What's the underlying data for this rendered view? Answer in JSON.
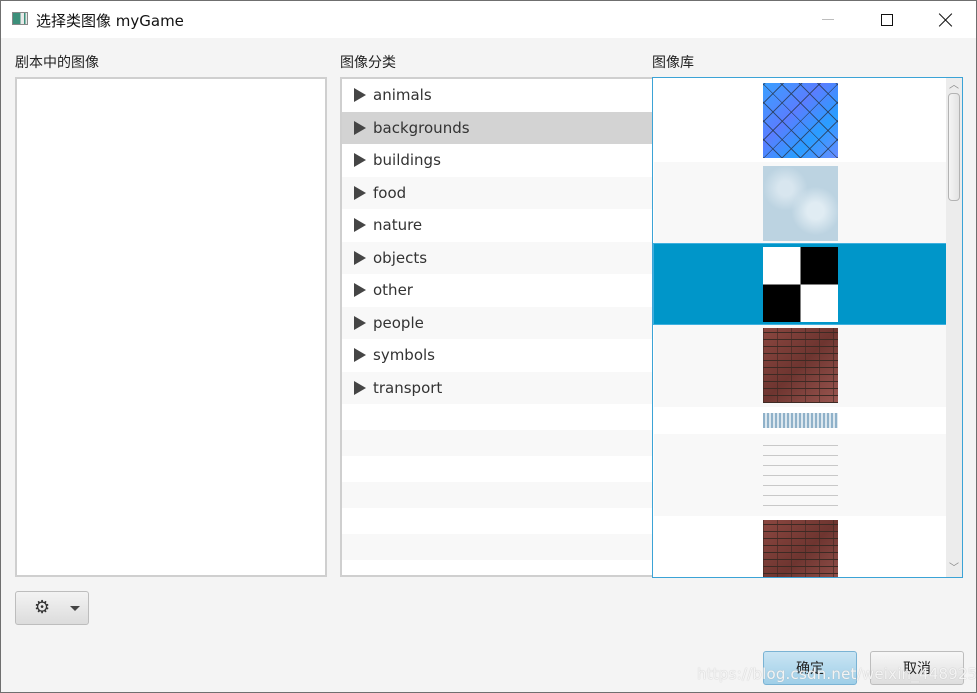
{
  "window": {
    "title": "选择类图像 myGame",
    "controls": [
      "minimize",
      "maximize",
      "close"
    ]
  },
  "left_panel": {
    "label": "剧本中的图像",
    "items": []
  },
  "category_panel": {
    "label": "图像分类",
    "selected": "backgrounds",
    "items": [
      {
        "label": "animals"
      },
      {
        "label": "backgrounds"
      },
      {
        "label": "buildings"
      },
      {
        "label": "food"
      },
      {
        "label": "nature"
      },
      {
        "label": "objects"
      },
      {
        "label": "other"
      },
      {
        "label": "people"
      },
      {
        "label": "symbols"
      },
      {
        "label": "transport"
      }
    ]
  },
  "gallery_panel": {
    "label": "图像库",
    "selected_index": 2,
    "items": [
      {
        "kind": "blue-diamond-tiles"
      },
      {
        "kind": "light-blue-marble"
      },
      {
        "kind": "black-white-checker"
      },
      {
        "kind": "red-brick"
      },
      {
        "kind": "blue-strip-texture"
      },
      {
        "kind": "handwritten-text-texture"
      },
      {
        "kind": "red-brick"
      }
    ]
  },
  "toolbar": {
    "settings_menu_icon": "gear-icon",
    "dropdown_icon": "caret-down-icon"
  },
  "footer": {
    "ok_label": "确定",
    "cancel_label": "取消",
    "watermark": "https://blog.csdn.net/weixin_44892517"
  }
}
